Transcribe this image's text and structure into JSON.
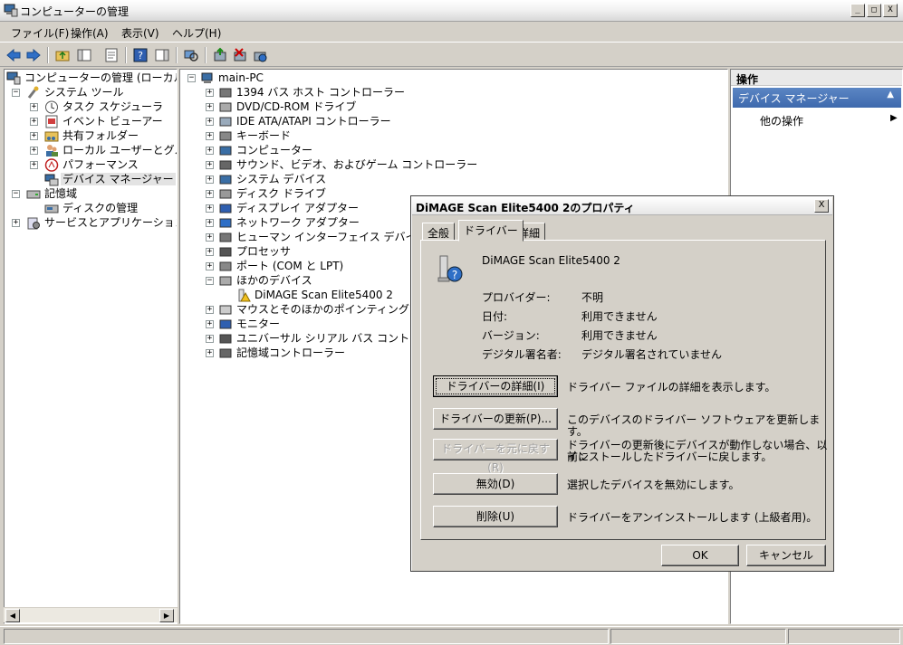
{
  "window": {
    "title": "コンピューターの管理",
    "min": "_",
    "max": "□",
    "close": "X"
  },
  "menu": [
    "ファイル(F)",
    "操作(A)",
    "表示(V)",
    "ヘルプ(H)"
  ],
  "tree": {
    "root": "コンピューターの管理 (ローカル)",
    "system_tools": "システム ツール",
    "task_scheduler": "タスク スケジューラ",
    "event_viewer": "イベント ビューアー",
    "shared_folders": "共有フォルダー",
    "local_users": "ローカル ユーザーとグループ",
    "performance": "パフォーマンス",
    "device_manager": "デバイス マネージャー",
    "storage": "記憶域",
    "disk_management": "ディスクの管理",
    "services_apps": "サービスとアプリケーション"
  },
  "devices": {
    "computer_name": "main-PC",
    "categories": [
      "1394 バス ホスト コントローラー",
      "DVD/CD-ROM ドライブ",
      "IDE ATA/ATAPI コントローラー",
      "キーボード",
      "コンピューター",
      "サウンド、ビデオ、およびゲーム コントローラー",
      "システム デバイス",
      "ディスク ドライブ",
      "ディスプレイ アダプター",
      "ネットワーク アダプター",
      "ヒューマン インターフェイス デバイス",
      "プロセッサ",
      "ポート (COM と LPT)",
      "ほかのデバイス",
      "DiMAGE Scan Elite5400 2",
      "マウスとそのほかのポインティング デバイス",
      "モニター",
      "ユニバーサル シリアル バス コントローラー",
      "記憶域コントローラー"
    ]
  },
  "actions": {
    "header": "操作",
    "section": "デバイス マネージャー",
    "more": "他の操作"
  },
  "dialog": {
    "title": "DiMAGE Scan Elite5400 2のプロパティ",
    "close": "X",
    "tabs": [
      "全般",
      "ドライバー",
      "詳細"
    ],
    "device_name": "DiMAGE Scan Elite5400 2",
    "props": [
      {
        "label": "プロバイダー:",
        "value": "不明"
      },
      {
        "label": "日付:",
        "value": "利用できません"
      },
      {
        "label": "バージョン:",
        "value": "利用できません"
      },
      {
        "label": "デジタル署名者:",
        "value": "デジタル署名されていません"
      }
    ],
    "buttons": [
      {
        "label": "ドライバーの詳細(I)",
        "desc": "ドライバー ファイルの詳細を表示します。"
      },
      {
        "label": "ドライバーの更新(P)...",
        "desc": "このデバイスのドライバー ソフトウェアを更新します。"
      },
      {
        "label": "ドライバーを元に戻す(R)",
        "desc1": "ドライバーの更新後にデバイスが動作しない場合、以前に",
        "desc2": "インストールしたドライバーに戻します。"
      },
      {
        "label": "無効(D)",
        "desc": "選択したデバイスを無効にします。"
      },
      {
        "label": "削除(U)",
        "desc": "ドライバーをアンインストールします (上級者用)。"
      }
    ],
    "ok": "OK",
    "cancel": "キャンセル"
  }
}
